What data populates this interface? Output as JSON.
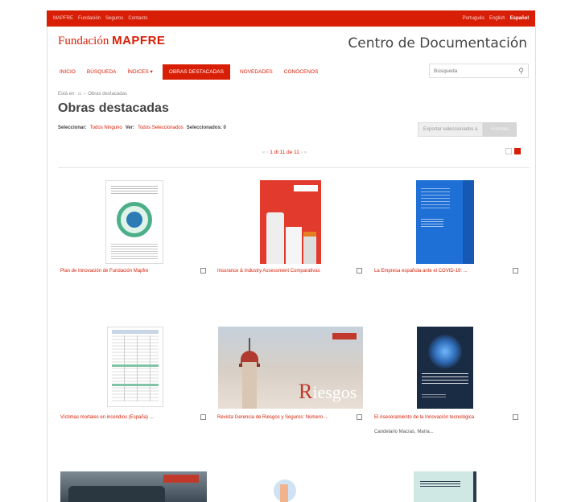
{
  "topbar": {
    "left_links": [
      "MAPFRE",
      "Fundación",
      "Seguros",
      "Contacto"
    ],
    "languages": [
      "Português",
      "English",
      "Español"
    ],
    "active_language": "Español"
  },
  "header": {
    "logo_script": "Fundación",
    "logo_brand": "MAPFRE",
    "site_title": "Centro de Documentación"
  },
  "nav": {
    "items": [
      "INICIO",
      "BÚSQUEDA",
      "ÍNDICES ▾",
      "OBRAS DESTACADAS",
      "NOVEDADES",
      "CONÓCENOS"
    ],
    "active": "OBRAS DESTACADAS"
  },
  "search": {
    "placeholder": "Búsqueda"
  },
  "breadcrumb": {
    "prefix": "Está en:",
    "current": "Obras destacadas"
  },
  "page_title": "Obras destacadas",
  "selection": {
    "select_label": "Seleccionar:",
    "select_value": "Todos Ninguno",
    "view_label": "Ver:",
    "view_value": "Todos Seleccionados",
    "selected_label": "Seleccionados: 0"
  },
  "export": {
    "button_label": "Exportar seleccionados a",
    "format_label": "Formato"
  },
  "pager": {
    "first": "«",
    "prev": "‹",
    "text": "1 di 11 de 11",
    "next": "›",
    "last": "»"
  },
  "items": [
    {
      "title": "Plan de Innovación de Fundación Mapfre",
      "author": ""
    },
    {
      "title": "Insurance & Industry Assessment Comparativas",
      "author": ""
    },
    {
      "title": "La Empresa española ante el COVID-19: ...",
      "author": ""
    },
    {
      "title": "Víctimas mortales en incendios (España) ...",
      "author": ""
    },
    {
      "title": "Revista Gerencia de Riesgos y Seguros: Número ...",
      "author": ""
    },
    {
      "title": "El Asesoramiento de la Innovación tecnológica",
      "author": "Candelario Macías, María..."
    }
  ],
  "featured_words": {
    "riesgos": "iesgos",
    "riesgos_cap": "R"
  },
  "colors": {
    "brand": "#d81e05",
    "text": "#444444"
  }
}
